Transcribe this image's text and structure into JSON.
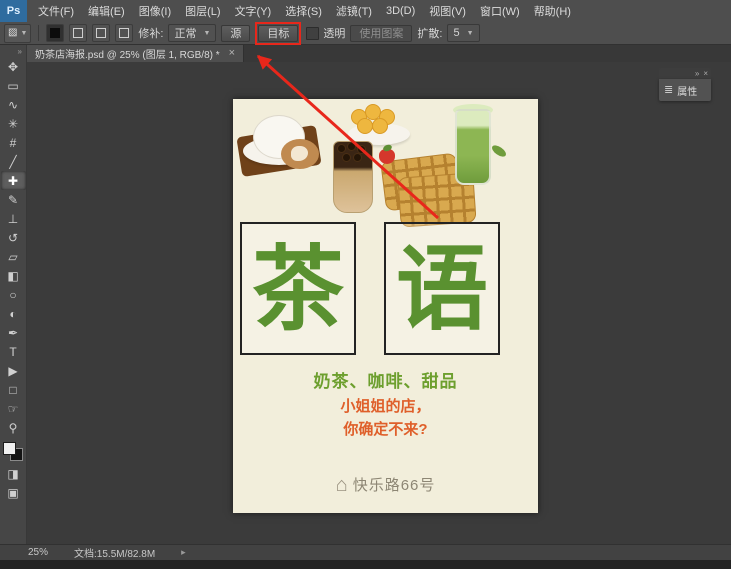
{
  "app": {
    "logo_text": "Ps"
  },
  "menubar": {
    "items": [
      "文件(F)",
      "编辑(E)",
      "图像(I)",
      "图层(L)",
      "文字(Y)",
      "选择(S)",
      "滤镜(T)",
      "3D(D)",
      "视图(V)",
      "窗口(W)",
      "帮助(H)"
    ]
  },
  "options_bar": {
    "tool_preset_icon": "patch-tool-icon",
    "mode_label": "修补:",
    "mode_value": "正常",
    "source_label": "源",
    "target_label": "目标",
    "transparent_label": "透明",
    "use_pattern_label": "使用图案",
    "spread_label": "扩散:",
    "spread_value": "5"
  },
  "document_tab": {
    "title": "奶茶店海报.psd @ 25% (图层 1, RGB/8) *",
    "close_glyph": "×"
  },
  "toolbar": {
    "collapse_glyph": "»",
    "tools": [
      {
        "name": "move-tool",
        "glyph": "✥"
      },
      {
        "name": "marquee-tool",
        "glyph": "▭"
      },
      {
        "name": "lasso-tool",
        "glyph": "∿"
      },
      {
        "name": "magic-wand-tool",
        "glyph": "✳"
      },
      {
        "name": "crop-tool",
        "glyph": "#"
      },
      {
        "name": "eyedropper-tool",
        "glyph": "╱"
      },
      {
        "name": "healing-patch-tool",
        "glyph": "✚"
      },
      {
        "name": "brush-tool",
        "glyph": "✎"
      },
      {
        "name": "clone-stamp-tool",
        "glyph": "⊥"
      },
      {
        "name": "history-brush-tool",
        "glyph": "↺"
      },
      {
        "name": "eraser-tool",
        "glyph": "▱"
      },
      {
        "name": "gradient-tool",
        "glyph": "◧"
      },
      {
        "name": "blur-tool",
        "glyph": "○"
      },
      {
        "name": "dodge-tool",
        "glyph": "◐"
      },
      {
        "name": "pen-tool",
        "glyph": "✒"
      },
      {
        "name": "type-tool",
        "glyph": "T"
      },
      {
        "name": "path-selection-tool",
        "glyph": "▶"
      },
      {
        "name": "shape-tool",
        "glyph": "□"
      },
      {
        "name": "hand-tool",
        "glyph": "☞"
      },
      {
        "name": "zoom-tool",
        "glyph": "⚲"
      }
    ],
    "extras": [
      {
        "name": "quick-mask-icon",
        "glyph": "◨"
      },
      {
        "name": "screen-mode-icon",
        "glyph": "▣"
      }
    ]
  },
  "properties_panel": {
    "label": "属性",
    "collapse_glyph": "»",
    "close_glyph": "×",
    "icon_glyph": "≣"
  },
  "poster": {
    "tea_char": "茶",
    "yu_char": "语",
    "tagline": "奶茶、咖啡、甜品",
    "line2": "小姐姐的店，",
    "line3": "你确定不来?",
    "house_glyph": "⌂",
    "address": "快乐路66号",
    "photos": [
      "coffee-latte",
      "egg-yolk-pastries",
      "bubble-tea",
      "waffles-strawberry",
      "matcha-drink"
    ],
    "colors": {
      "background": "#f2eedb",
      "char_green": "#5a9130",
      "tagline_green": "#6d9f2e",
      "orange": "#df5f2a",
      "address_gray": "#8d8674"
    }
  },
  "status_bar": {
    "zoom": "25%",
    "doc_info": "文档:15.5M/82.8M",
    "arrow_glyph": "▸"
  },
  "annotation": {
    "color": "#e8271b"
  }
}
